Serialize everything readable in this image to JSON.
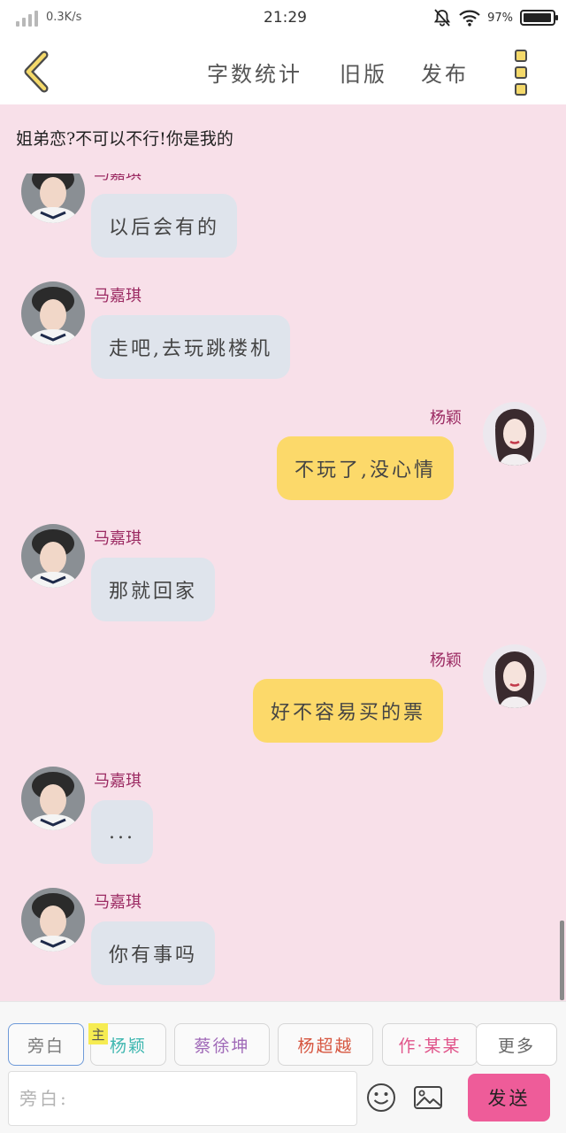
{
  "status_bar": {
    "network_speed": "0.3K/s",
    "time": "21:29",
    "battery": "97%",
    "battery_level": 0.97
  },
  "header": {
    "actions": [
      {
        "label": "字数统计"
      },
      {
        "label": "旧版"
      },
      {
        "label": "发布"
      }
    ]
  },
  "story": {
    "title": "姐弟恋?不可以不行!你是我的"
  },
  "messages": [
    {
      "side": "left",
      "sender": "马嘉琪",
      "text": "以后会有的"
    },
    {
      "side": "left",
      "sender": "马嘉琪",
      "text": "走吧,去玩跳楼机"
    },
    {
      "side": "right",
      "sender": "杨颖",
      "text": "不玩了,没心情"
    },
    {
      "side": "left",
      "sender": "马嘉琪",
      "text": "那就回家"
    },
    {
      "side": "right",
      "sender": "杨颖",
      "text": "好不容易买的票"
    },
    {
      "side": "left",
      "sender": "马嘉琪",
      "text": "..."
    },
    {
      "side": "left",
      "sender": "马嘉琪",
      "text": "你有事吗"
    }
  ],
  "composer": {
    "roles": [
      {
        "label": "旁白",
        "color": "#7a7a7a"
      },
      {
        "label": "杨颖",
        "color": "#3fb7b0"
      },
      {
        "label": "蔡徐坤",
        "color": "#a06ab8"
      },
      {
        "label": "杨超越",
        "color": "#d6553f"
      },
      {
        "label": "作·某某",
        "color": "#e0548a"
      },
      {
        "label": "更多",
        "color": "#666666"
      }
    ],
    "host_badge": "主",
    "input_placeholder": "旁白:",
    "send_label": "发送",
    "icons": [
      "smiley-icon",
      "image-icon"
    ]
  },
  "colors": {
    "background": "#f8e0e9",
    "left_bubble": "#dfe4ec",
    "right_bubble": "#fcd96a",
    "sender_name": "#9c2b63",
    "send_button": "#ee5c99",
    "accent_yellow": "#f4d96a"
  }
}
